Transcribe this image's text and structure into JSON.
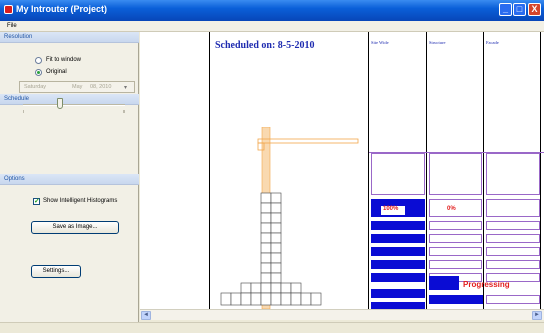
{
  "window": {
    "title": "My Introuter (Project)",
    "minimize": "_",
    "maximize": "□",
    "close": "X"
  },
  "menu": {
    "file": "File"
  },
  "resolution": {
    "header": "Resolution",
    "options": [
      {
        "label": "Fit to window",
        "selected": false
      },
      {
        "label": "Original",
        "selected": true
      }
    ]
  },
  "schedule": {
    "header": "Schedule",
    "date_day": "Saturday",
    "date_month": "May",
    "date_rest": "08, 2010",
    "slider_value_fraction": 0.35
  },
  "options": {
    "header": "Options",
    "show_histograms_label": "Show Intelligent Histograms",
    "show_histograms_checked": true,
    "save_image_button": "Save as Image...",
    "settings_button": "Settings..."
  },
  "view": {
    "scheduled_on": "Scheduled on: 8-5-2010",
    "columns": [
      "Site Wide",
      "Structure",
      "Facade"
    ],
    "percent_labels": [
      "100%",
      "0%"
    ],
    "progressing_label": "Progressing",
    "colors": {
      "bar_blue": "#0a0cd4",
      "crane": "#f2a64a",
      "purple": "#9a68c8",
      "red": "#e21e1e"
    }
  },
  "scroll": {
    "left_arrow": "◄",
    "right_arrow": "►"
  }
}
